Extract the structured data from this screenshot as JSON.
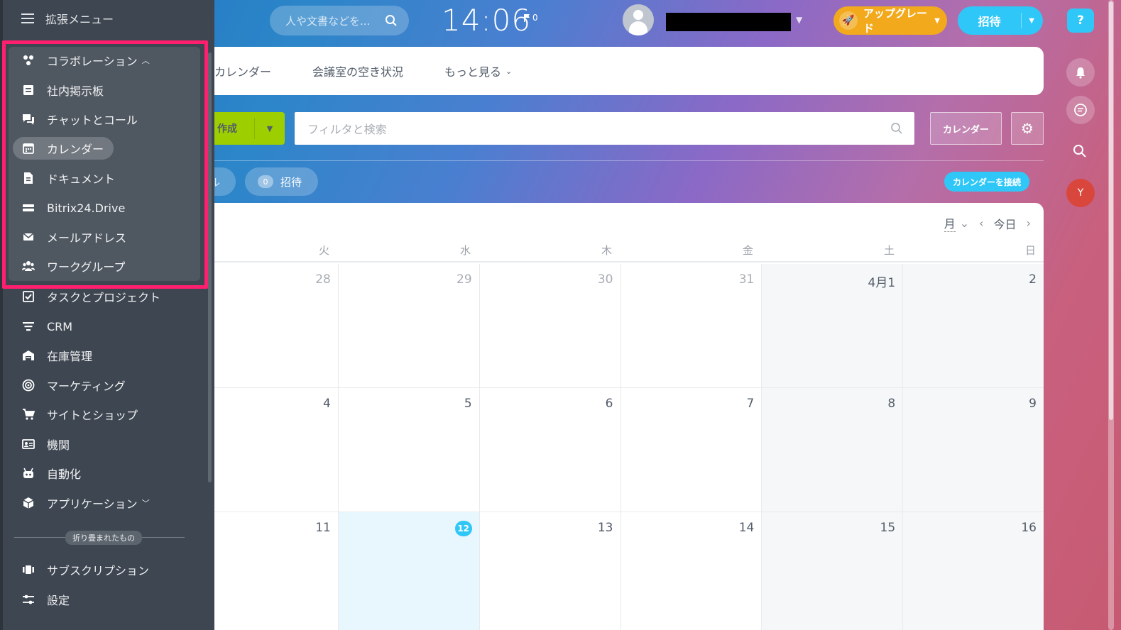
{
  "header": {
    "search_placeholder": "人や文書などを...",
    "clock": "14:06",
    "flag_count": "0",
    "upgrade_label": "アップグレード",
    "invite_label": "招待"
  },
  "rail": {
    "help_label": "?",
    "avatar_initial": "Y"
  },
  "tabs": [
    {
      "label": "カレンダー"
    },
    {
      "label": "会議室の空き状況"
    },
    {
      "label": "もっと見る"
    }
  ],
  "toolbar": {
    "create_label": "作成",
    "filter_placeholder": "フィルタと検索",
    "calendars_label": "カレンダー"
  },
  "subbar": {
    "partial_label": "ル",
    "invite_count": "0",
    "invite_label": "招待",
    "connect_label": "カレンダーを接続"
  },
  "calendar": {
    "view_selector": "月",
    "today_label": "今日",
    "weekdays": [
      "火",
      "水",
      "木",
      "金",
      "土",
      "日"
    ],
    "weeks": [
      [
        "28",
        "29",
        "30",
        "31",
        "4月1",
        "2"
      ],
      [
        "4",
        "5",
        "6",
        "7",
        "8",
        "9"
      ],
      [
        "11",
        "12",
        "13",
        "14",
        "15",
        "16"
      ]
    ],
    "today": "12"
  },
  "sidebar": {
    "title": "拡張メニュー",
    "collab_label": "コラボレーション",
    "items": [
      {
        "label": "社内掲示板",
        "icon": "newspaper-icon"
      },
      {
        "label": "チャットとコール",
        "icon": "chat-icon"
      },
      {
        "label": "カレンダー",
        "icon": "calendar-icon"
      },
      {
        "label": "ドキュメント",
        "icon": "document-icon"
      },
      {
        "label": "Bitrix24.Drive",
        "icon": "drive-icon"
      },
      {
        "label": "メールアドレス",
        "icon": "mail-icon"
      },
      {
        "label": "ワークグループ",
        "icon": "group-icon"
      },
      {
        "label": "タスクとプロジェクト",
        "icon": "task-icon"
      },
      {
        "label": "CRM",
        "icon": "filter-icon"
      },
      {
        "label": "在庫管理",
        "icon": "warehouse-icon"
      },
      {
        "label": "マーケティング",
        "icon": "target-icon"
      },
      {
        "label": "サイトとショップ",
        "icon": "cart-icon"
      },
      {
        "label": "機関",
        "icon": "id-card-icon"
      },
      {
        "label": "自動化",
        "icon": "robot-icon"
      },
      {
        "label": "アプリケーション",
        "icon": "cube-icon"
      }
    ],
    "collapsed_label": "折り畳まれたもの",
    "bottom_items": [
      {
        "label": "サブスクリプション",
        "icon": "subscription-icon"
      },
      {
        "label": "設定",
        "icon": "settings-icon"
      }
    ]
  }
}
